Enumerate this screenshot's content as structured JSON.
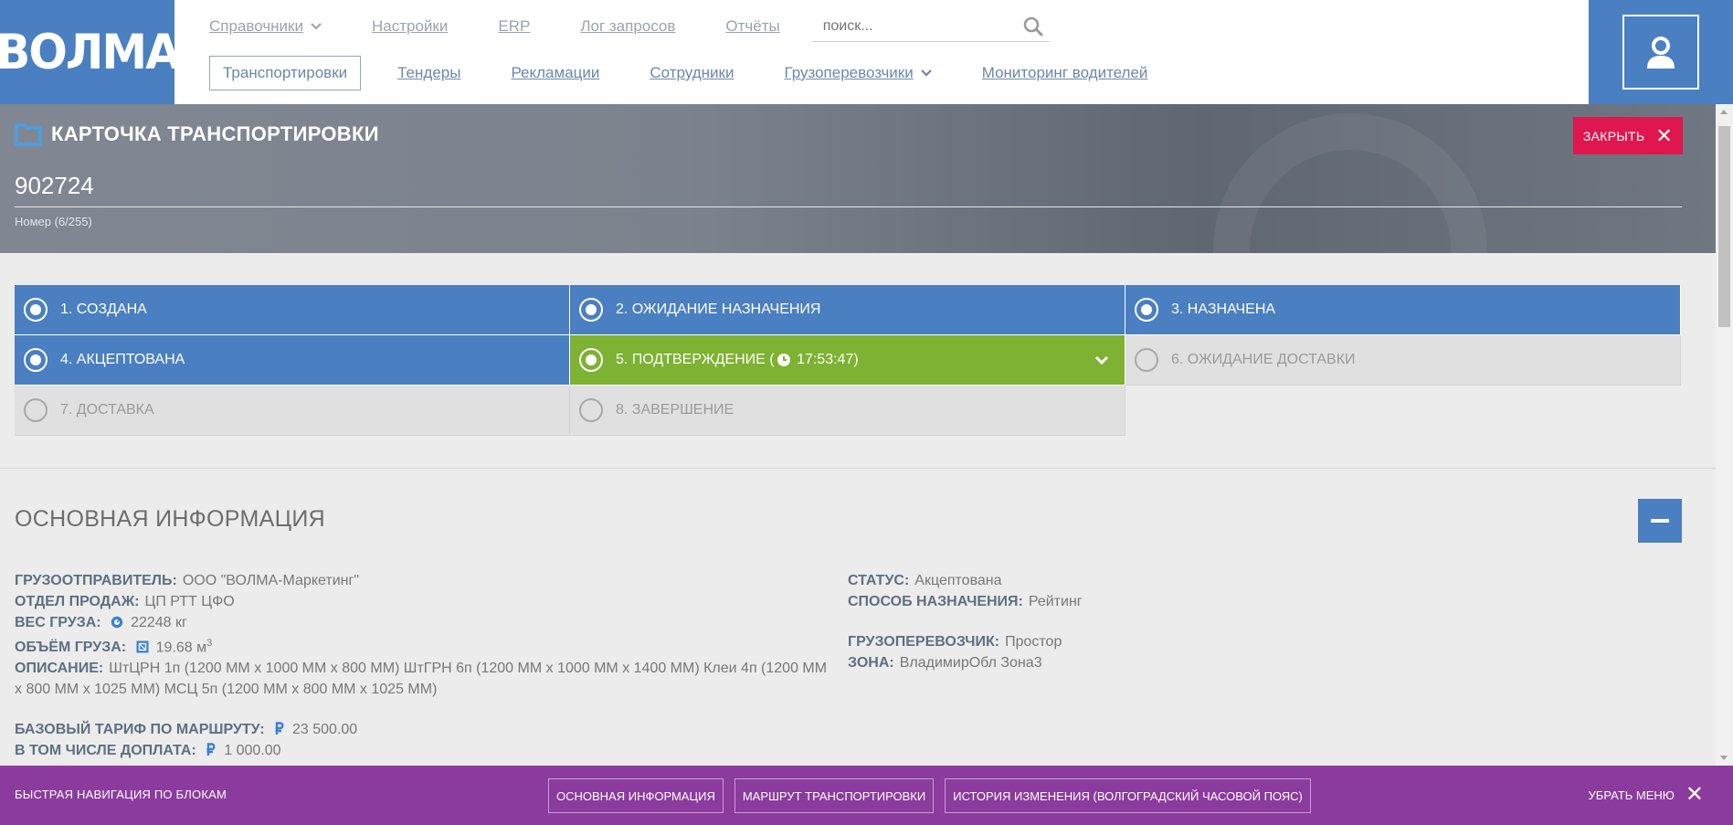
{
  "colors": {
    "brand_blue": "#4a7fc1",
    "close_red": "#e0174f",
    "current_green": "#7db232",
    "bottom_purple": "#8b3b9d"
  },
  "header": {
    "logo_text": "ВОЛМА",
    "nav_top": [
      {
        "label": "Справочники",
        "has_dropdown": true
      },
      {
        "label": "Настройки"
      },
      {
        "label": "ERP"
      },
      {
        "label": "Лог запросов"
      },
      {
        "label": "Отчёты"
      }
    ],
    "search_placeholder": "поиск...",
    "nav_bottom": [
      {
        "label": "Транспортировки",
        "active": true
      },
      {
        "label": "Тендеры"
      },
      {
        "label": "Рекламации"
      },
      {
        "label": "Сотрудники"
      },
      {
        "label": "Грузоперевозчики",
        "has_dropdown": true
      },
      {
        "label": "Мониторинг водителей"
      }
    ],
    "icons": [
      "search-icon",
      "user-icon",
      "chevron-down-icon"
    ]
  },
  "card": {
    "title": "КАРТОЧКА ТРАНСПОРТИРОВКИ",
    "close_label": "ЗАКРЫТЬ",
    "number_value": "902724",
    "number_hint": "Номер (6/255)"
  },
  "statuses": [
    {
      "label": "1. СОЗДАНА",
      "state": "done"
    },
    {
      "label": "2. ОЖИДАНИЕ НАЗНАЧЕНИЯ",
      "state": "done"
    },
    {
      "label": "3. НАЗНАЧЕНА",
      "state": "done"
    },
    {
      "label": "4. АКЦЕПТОВАНА",
      "state": "done"
    },
    {
      "label_prefix": "5. ПОДТВЕРЖДЕНИЕ (",
      "time": "17:53:47",
      "label_suffix": ")",
      "state": "current"
    },
    {
      "label": "6. ОЖИДАНИЕ ДОСТАВКИ",
      "state": "todo"
    },
    {
      "label": "7. ДОСТАВКА",
      "state": "todo"
    },
    {
      "label": "8. ЗАВЕРШЕНИЕ",
      "state": "todo"
    }
  ],
  "main_info": {
    "title": "ОСНОВНАЯ ИНФОРМАЦИЯ",
    "shipper_label": "ГРУЗООТПРАВИТЕЛЬ:",
    "shipper_value": "ООО \"ВОЛМА-Маркетинг\"",
    "sales_label": "ОТДЕЛ ПРОДАЖ:",
    "sales_value": "ЦП РТТ ЦФО",
    "weight_label": "ВЕС ГРУЗА:",
    "weight_value": "22248 кг",
    "volume_label": "ОБЪЁМ ГРУЗА:",
    "volume_value": "19.68 м",
    "volume_sup": "3",
    "desc_label": "ОПИСАНИЕ:",
    "desc_value": "ШтЦРН 1п (1200 ММ х 1000 ММ х 800 ММ) ШтГРН 6п (1200 ММ х 1000 ММ х 1400 ММ) Клеи 4п (1200 ММ х 800 ММ х 1025 ММ) МСЦ 5п (1200 ММ х 800 ММ х 1025 ММ)",
    "tariff_label": "БАЗОВЫЙ ТАРИФ ПО МАРШРУТУ:",
    "tariff_value": "23 500.00",
    "surcharge_label": "В ТОМ ЧИСЛЕ ДОПЛАТА:",
    "surcharge_value": "1 000.00",
    "status_label": "СТАТУС:",
    "status_value": "Акцептована",
    "method_label": "СПОСОБ НАЗНАЧЕНИЯ:",
    "method_value": "Рейтинг",
    "carrier_label": "ГРУЗОПЕРЕВОЗЧИК:",
    "carrier_value": "Простор",
    "zone_label": "ЗОНА:",
    "zone_value": "ВладимирОбл Зона3"
  },
  "bottom_nav": {
    "label": "БЫСТРАЯ НАВИГАЦИЯ ПО БЛОКАМ",
    "buttons": [
      "ОСНОВНАЯ ИНФОРМАЦИЯ",
      "МАРШРУТ ТРАНСПОРТИРОВКИ",
      "ИСТОРИЯ ИЗМЕНЕНИЯ (ВОЛГОГРАДСКИЙ ЧАСОВОЙ ПОЯС)"
    ],
    "hide_label": "УБРАТЬ МЕНЮ"
  }
}
